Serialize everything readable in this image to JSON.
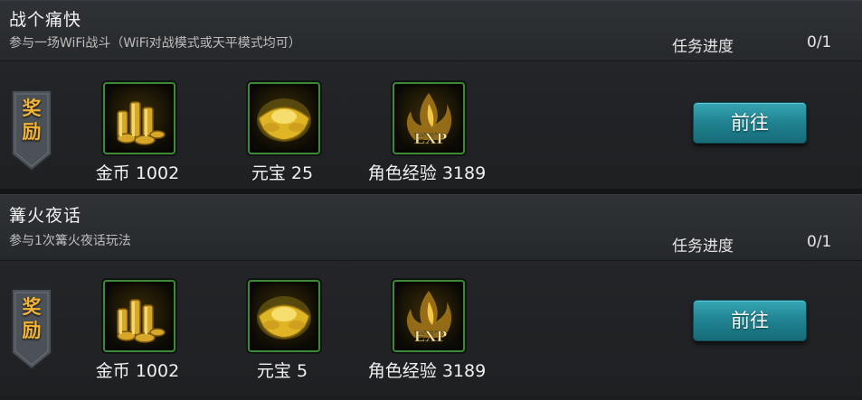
{
  "tasks": [
    {
      "title": "战个痛快",
      "description": "参与一场WiFi战斗（WiFi对战模式或天平模式均可）",
      "progress_label": "任务进度",
      "progress_value": "0/1",
      "reward_badge": "奖励",
      "rewards": [
        {
          "label": "金币 1002",
          "icon": "gold-coins-icon"
        },
        {
          "label": "元宝 25",
          "icon": "gold-ingot-icon"
        },
        {
          "label": "角色经验 3189",
          "icon": "exp-icon",
          "icon_text": "EXP"
        }
      ],
      "button_label": "前往"
    },
    {
      "title": "篝火夜话",
      "description": "参与1次篝火夜话玩法",
      "progress_label": "任务进度",
      "progress_value": "0/1",
      "reward_badge": "奖励",
      "rewards": [
        {
          "label": "金币 1002",
          "icon": "gold-coins-icon"
        },
        {
          "label": "元宝 5",
          "icon": "gold-ingot-icon"
        },
        {
          "label": "角色经验 3189",
          "icon": "exp-icon",
          "icon_text": "EXP"
        }
      ],
      "button_label": "前往"
    }
  ],
  "colors": {
    "badge_text": "#f2b436",
    "button": "#1e7f8d",
    "icon_border": "#3d8a36"
  }
}
